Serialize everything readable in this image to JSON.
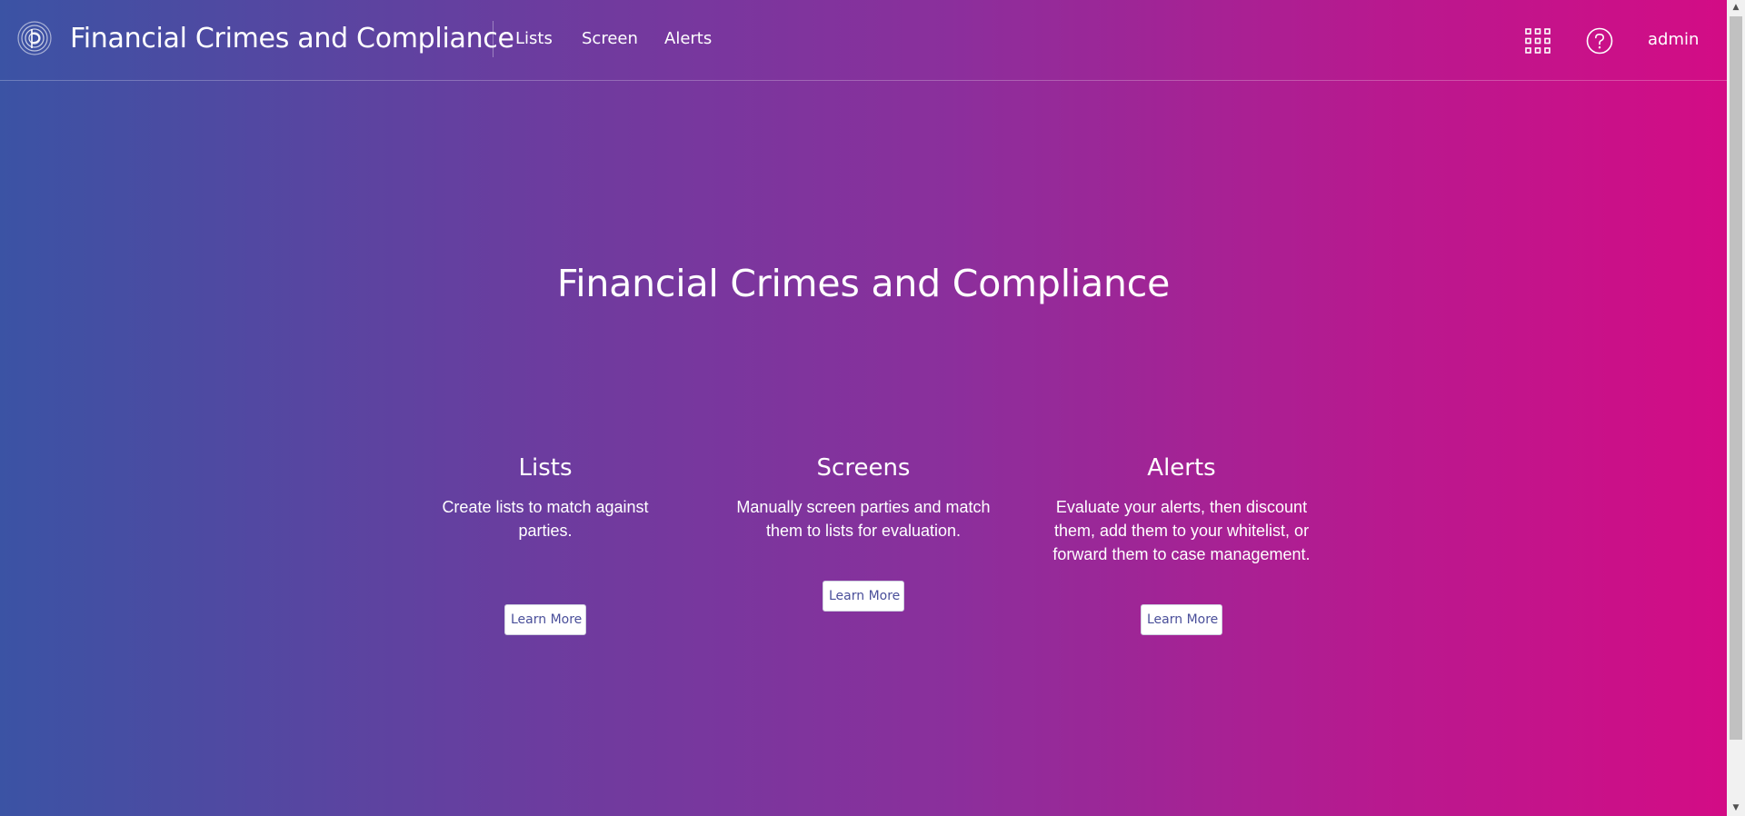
{
  "header": {
    "app_title": "Financial Crimes and Compliance",
    "nav": {
      "lists": "Lists",
      "screen": "Screen",
      "alerts": "Alerts"
    },
    "user": "admin"
  },
  "hero": {
    "title": "Financial Crimes and Compliance"
  },
  "features": {
    "lists": {
      "title": "Lists",
      "description": "Create lists to match against parties.",
      "button": "Learn More"
    },
    "screens": {
      "title": "Screens",
      "description": "Manually screen parties and match them to lists for evaluation.",
      "button": "Learn More"
    },
    "alerts": {
      "title": "Alerts",
      "description": "Evaluate your alerts, then discount them, add them to your whitelist, or forward them to case management.",
      "button": "Learn More"
    }
  },
  "icons": {
    "logo": "pitney-bowes-logo-icon",
    "apps": "grid-apps-icon",
    "help": "help-circle-icon"
  },
  "colors": {
    "gradient_start": "#3b53a4",
    "gradient_end": "#d30c85",
    "button_text": "#4a4f9a"
  }
}
